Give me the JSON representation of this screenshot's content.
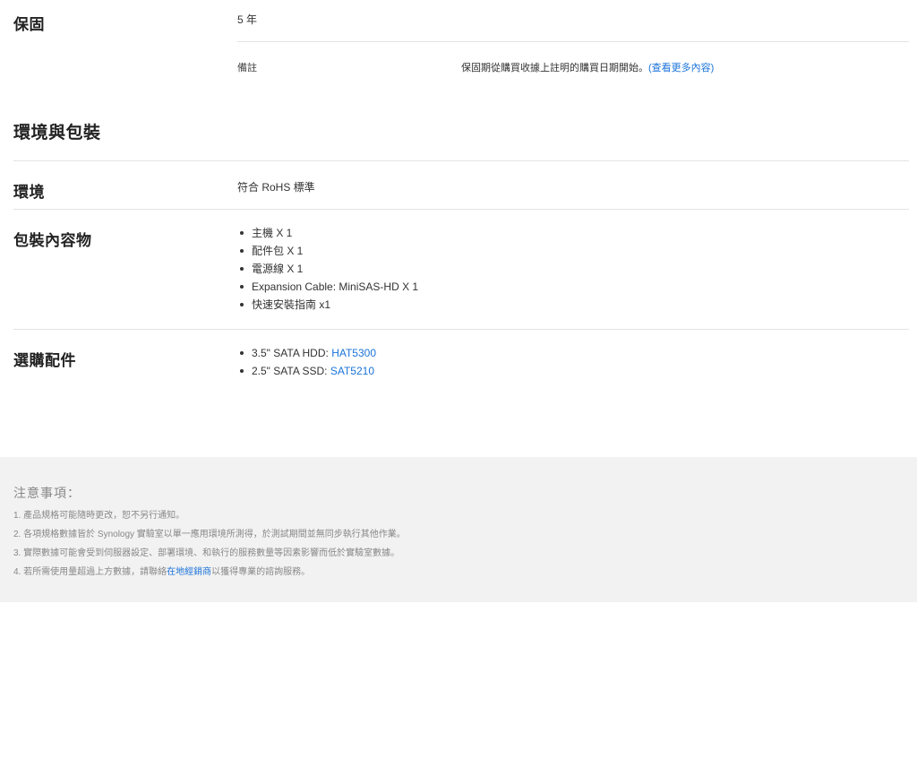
{
  "warranty": {
    "title": "保固",
    "value": "5 年",
    "note_label": "備註",
    "note_text": "保固期從購買收據上註明的購買日期開始。",
    "note_link": "(查看更多內容)"
  },
  "section": {
    "title": "環境與包裝"
  },
  "environment": {
    "title": "環境",
    "value": "符合 RoHS 標準"
  },
  "package": {
    "title": "包裝內容物",
    "items": [
      "主機 X 1",
      "配件包 X 1",
      "電源線 X 1",
      "Expansion Cable: MiniSAS-HD X 1",
      "快速安裝指南 x1"
    ]
  },
  "accessories": {
    "title": "選購配件",
    "items": [
      {
        "label": "3.5\" SATA HDD: ",
        "link": "HAT5300"
      },
      {
        "label": "2.5\" SATA SSD: ",
        "link": "SAT5210"
      }
    ]
  },
  "notes": {
    "title": "注意事項：",
    "items": [
      "1. 產品規格可能隨時更改，恕不另行通知。",
      "2. 各項規格數據皆於 Synology 實驗室以單一應用環境所測得，於測試期間並無同步執行其他作業。",
      "3. 實際數據可能會受到伺服器設定、部署環境、和執行的服務數量等因素影響而低於實驗室數據。"
    ],
    "item4_prefix": "4. 若所需使用量超過上方數據，請聯絡",
    "item4_link": "在地經銷商",
    "item4_suffix": "以獲得專業的諮詢服務。"
  }
}
